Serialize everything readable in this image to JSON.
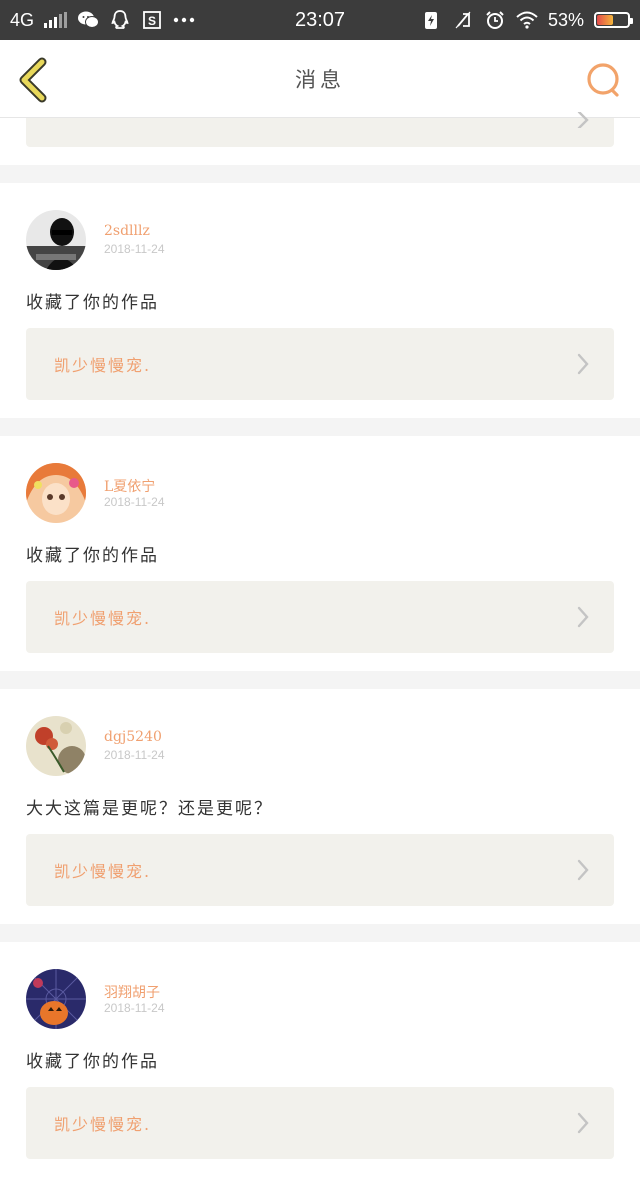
{
  "statusbar": {
    "network": "4G",
    "time": "23:07",
    "battery_percent": "53%",
    "battery_level": 0.53,
    "left_icons": [
      "wechat-icon",
      "qq-icon",
      "s-app-icon",
      "more-dots-icon"
    ],
    "right_icons": [
      "battery-saver-icon",
      "vibrate-off-icon",
      "alarm-icon",
      "wifi-icon"
    ]
  },
  "header": {
    "title": "消息",
    "back_icon": "chevron-left-icon",
    "search_icon": "search-icon",
    "accent_color": "#f2a36a",
    "back_color": "#e8d85a"
  },
  "messages": [
    {
      "username": "2sdlllz",
      "date": "2018-11-24",
      "text": "收藏了你的作品",
      "work_title": "凯少慢慢宠.",
      "avatar_colors": [
        "#111111",
        "#ffffff"
      ]
    },
    {
      "username": "L夏依宁",
      "date": "2018-11-24",
      "text": "收藏了你的作品",
      "work_title": "凯少慢慢宠.",
      "avatar_colors": [
        "#f0a070",
        "#f6d0a0"
      ]
    },
    {
      "username": "dgj5240",
      "date": "2018-11-24",
      "text": "大大这篇是更呢？还是更呢？",
      "work_title": "凯少慢慢宠.",
      "avatar_colors": [
        "#d8d0b8",
        "#b03a2a"
      ]
    },
    {
      "username": "羽翔胡子",
      "date": "2018-11-24",
      "text": "收藏了你的作品",
      "work_title": "凯少慢慢宠.",
      "avatar_colors": [
        "#2a2a6a",
        "#e8762a"
      ]
    }
  ]
}
